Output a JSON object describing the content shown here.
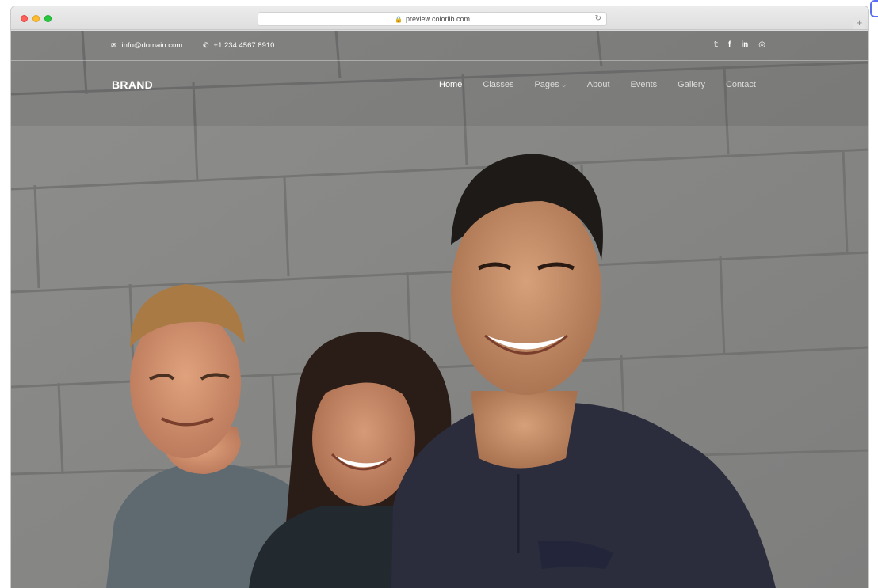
{
  "browser": {
    "url": "preview.colorlib.com",
    "lock_icon": "lock-icon",
    "reload_icon": "reload-icon",
    "newtab_label": "+"
  },
  "topbar": {
    "email": "info@domain.com",
    "email_icon": "envelope-icon",
    "phone": "+1 234 4567 8910",
    "phone_icon": "phone-icon",
    "social": [
      {
        "icon": "twitter-icon",
        "glyph": "𝕥"
      },
      {
        "icon": "facebook-icon",
        "glyph": "f"
      },
      {
        "icon": "linkedin-icon",
        "glyph": "in"
      },
      {
        "icon": "instagram-icon",
        "glyph": "◎"
      }
    ]
  },
  "navbar": {
    "brand": "BRAND",
    "items": [
      {
        "label": "Home",
        "active": true
      },
      {
        "label": "Classes",
        "active": false
      },
      {
        "label": "Pages",
        "active": false,
        "dropdown": true
      },
      {
        "label": "About",
        "active": false
      },
      {
        "label": "Events",
        "active": false
      },
      {
        "label": "Gallery",
        "active": false
      },
      {
        "label": "Contact",
        "active": false
      }
    ]
  },
  "hero": {
    "image_subject": "three-smiling-people-against-block-wall"
  },
  "colors": {
    "wall": "#8d8d8d",
    "text": "#ffffff",
    "accent_badge": "#5a6ef0"
  }
}
